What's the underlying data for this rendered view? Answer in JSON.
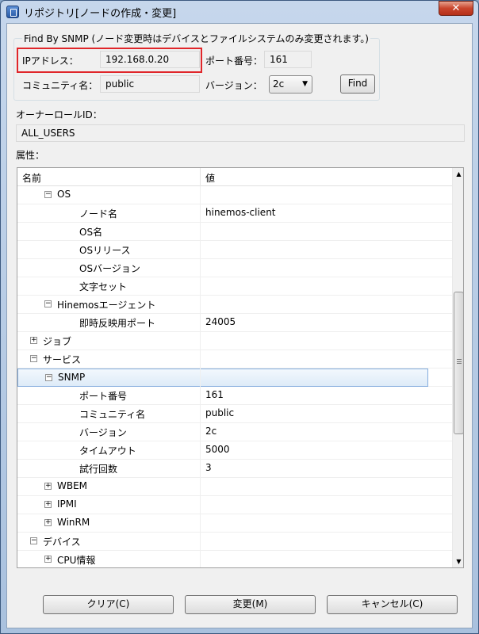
{
  "window": {
    "title": "リポジトリ[ノードの作成・変更]",
    "close_label": "✕"
  },
  "snmp_group": {
    "legend": "Find By SNMP (ノード変更時はデバイスとファイルシステムのみ変更されます。)",
    "ip_label": "IPアドレス：",
    "ip_value": "192.168.0.20",
    "port_label": "ポート番号：",
    "port_value": "161",
    "community_label": "コミュニティ名：",
    "community_value": "public",
    "version_label": "バージョン：",
    "version_value": "2c",
    "find_label": "Find"
  },
  "owner": {
    "label": "オーナーロールID：",
    "value": "ALL_USERS"
  },
  "attributes": {
    "label": "属性：",
    "columns": [
      "名前",
      "値"
    ],
    "rows": [
      {
        "level": 1,
        "toggle": "−",
        "name": "OS",
        "value": ""
      },
      {
        "level": 2,
        "toggle": "",
        "name": "ノード名",
        "value": "hinemos-client"
      },
      {
        "level": 2,
        "toggle": "",
        "name": "OS名",
        "value": ""
      },
      {
        "level": 2,
        "toggle": "",
        "name": "OSリリース",
        "value": ""
      },
      {
        "level": 2,
        "toggle": "",
        "name": "OSバージョン",
        "value": ""
      },
      {
        "level": 2,
        "toggle": "",
        "name": "文字セット",
        "value": ""
      },
      {
        "level": 1,
        "toggle": "−",
        "name": "Hinemosエージェント",
        "value": ""
      },
      {
        "level": 2,
        "toggle": "",
        "name": "即時反映用ポート",
        "value": "24005"
      },
      {
        "level": 0,
        "toggle": "+",
        "name": "ジョブ",
        "value": ""
      },
      {
        "level": 0,
        "toggle": "−",
        "name": "サービス",
        "value": ""
      },
      {
        "level": 1,
        "toggle": "−",
        "name": "SNMP",
        "value": "",
        "selected": true
      },
      {
        "level": 2,
        "toggle": "",
        "name": "ポート番号",
        "value": "161"
      },
      {
        "level": 2,
        "toggle": "",
        "name": "コミュニティ名",
        "value": "public"
      },
      {
        "level": 2,
        "toggle": "",
        "name": "バージョン",
        "value": "2c"
      },
      {
        "level": 2,
        "toggle": "",
        "name": "タイムアウト",
        "value": "5000"
      },
      {
        "level": 2,
        "toggle": "",
        "name": "試行回数",
        "value": "3"
      },
      {
        "level": 1,
        "toggle": "+",
        "name": "WBEM",
        "value": ""
      },
      {
        "level": 1,
        "toggle": "+",
        "name": "IPMI",
        "value": ""
      },
      {
        "level": 1,
        "toggle": "+",
        "name": "WinRM",
        "value": ""
      },
      {
        "level": 0,
        "toggle": "−",
        "name": "デバイス",
        "value": ""
      },
      {
        "level": 1,
        "toggle": "+",
        "name": "CPU情報",
        "value": ""
      }
    ]
  },
  "buttons": {
    "clear": "クリア(C)",
    "change": "変更(M)",
    "cancel": "キャンセル(C)"
  }
}
